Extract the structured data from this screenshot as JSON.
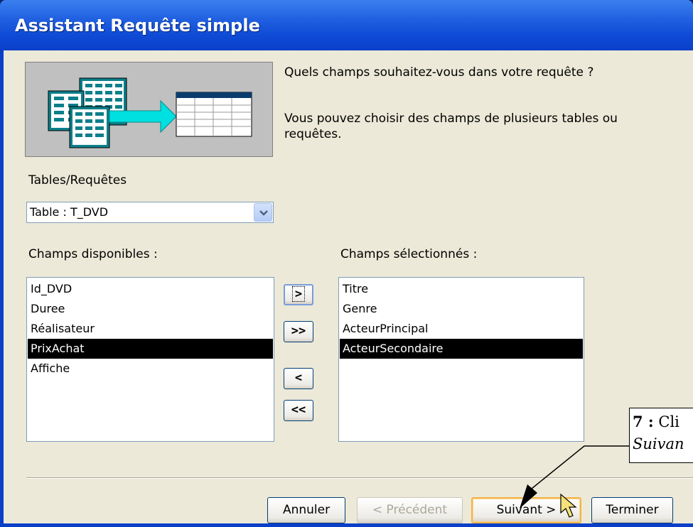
{
  "window": {
    "title": "Assistant Requête simple"
  },
  "header": {
    "question": "Quels champs souhaitez-vous dans votre requête ?",
    "hint_line1": "Vous pouvez choisir des champs de plusieurs tables ou",
    "hint_line2": "requêtes."
  },
  "tables": {
    "label": "Tables/Requêtes",
    "selected": "Table : T_DVD"
  },
  "available": {
    "label": "Champs disponibles :",
    "items": [
      "Id_DVD",
      "Duree",
      "Réalisateur",
      "PrixAchat",
      "Affiche"
    ],
    "selected_index": 3
  },
  "selected_fields": {
    "label": "Champs sélectionnés :",
    "items": [
      "Titre",
      "Genre",
      "ActeurPrincipal",
      "ActeurSecondaire"
    ],
    "selected_index": 3
  },
  "move_buttons": {
    "add_one": ">",
    "add_all": ">>",
    "remove_one": "<",
    "remove_all": "<<"
  },
  "footer": {
    "cancel": "Annuler",
    "previous": "< Précédent",
    "next": "Suivant >",
    "finish": "Terminer"
  },
  "annotation": {
    "number": "7 :",
    "line1_rest": "Cli",
    "line2": "Suivan"
  },
  "colors": {
    "titlebar": "#0a3fc8",
    "dialog_bg": "#ece9d8",
    "selection": "#000000",
    "default_button_border": "#f4b447"
  }
}
